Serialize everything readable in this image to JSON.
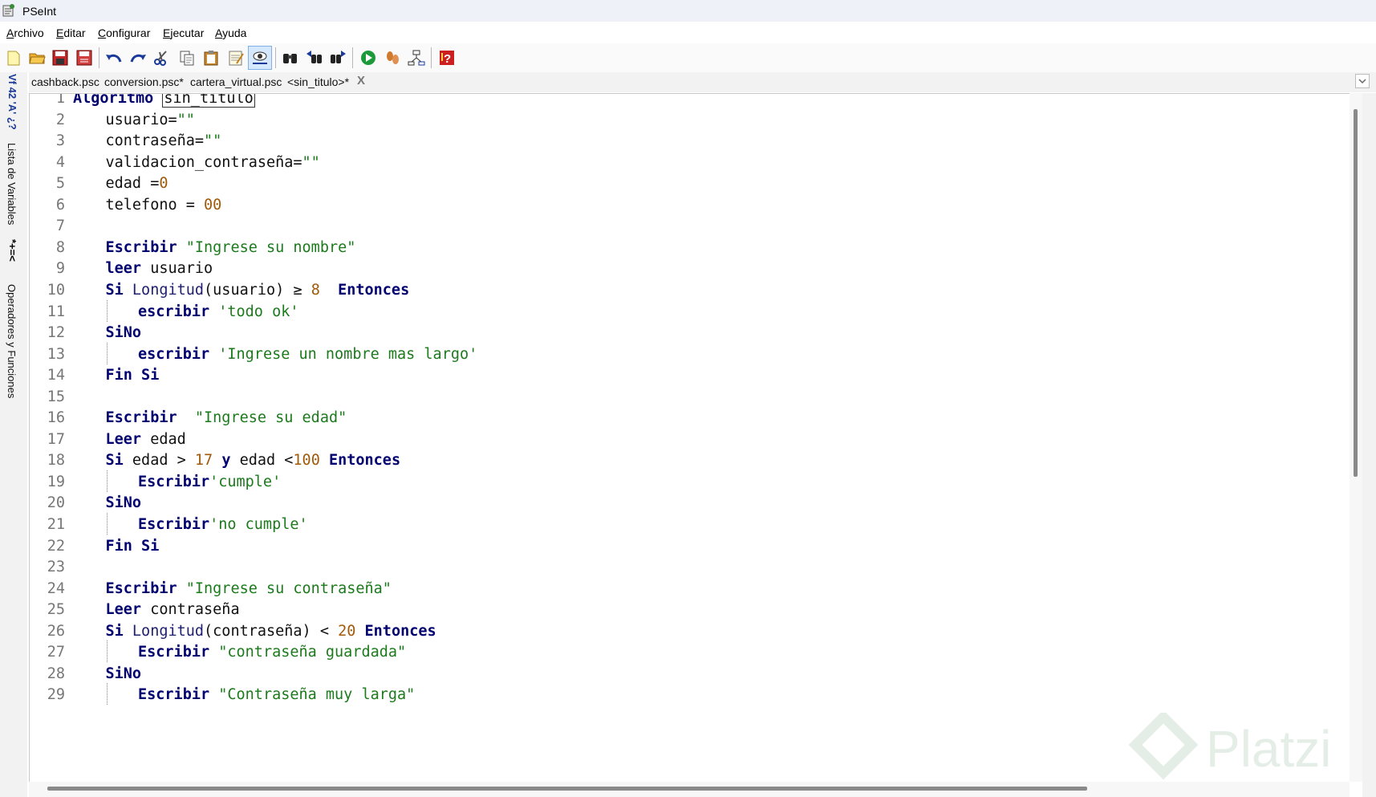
{
  "window": {
    "title": "PSeInt"
  },
  "menu": [
    {
      "label": "Archivo",
      "accel": "A",
      "rest": "rchivo"
    },
    {
      "label": "Editar",
      "accel": "E",
      "rest": "ditar"
    },
    {
      "label": "Configurar",
      "accel": "C",
      "rest": "onfigurar"
    },
    {
      "label": "Ejecutar",
      "accel": "E",
      "rest": "jecutar"
    },
    {
      "label": "Ayuda",
      "accel": "A",
      "rest": "yuda"
    }
  ],
  "toolbar": [
    "new-file-icon",
    "open-folder-icon",
    "save-icon",
    "save-as-icon",
    "undo-icon",
    "redo-icon",
    "cut-icon",
    "copy-icon",
    "paste-icon",
    "edit-icon",
    "highlight-icon",
    "find-icon",
    "find-previous-icon",
    "find-next-icon",
    "run-icon",
    "step-by-step-icon",
    "flowchart-icon",
    "help-icon"
  ],
  "tabs": [
    {
      "label": "cashback.psc"
    },
    {
      "label": "conversion.psc*"
    },
    {
      "label": "cartera_virtual.psc"
    },
    {
      "label": "<sin_titulo>*",
      "active": true
    }
  ],
  "tab_close": "X",
  "side_panel": {
    "variables_label": "Lista de Variables",
    "variables_glyphs": "Vf 42 'A' ¿?",
    "operators_label": "Operadores y Funciones",
    "operators_glyphs": "*+=<"
  },
  "code_lines": [
    {
      "n": "1",
      "indent": 0,
      "tokens": [
        [
          "kw",
          "Algoritmo"
        ],
        [
          "id",
          " "
        ],
        [
          "box",
          "sin_titulo"
        ]
      ]
    },
    {
      "n": "2",
      "indent": 1,
      "tokens": [
        [
          "id",
          "usuario="
        ],
        [
          "str",
          "\"\""
        ]
      ]
    },
    {
      "n": "3",
      "indent": 1,
      "tokens": [
        [
          "id",
          "contraseña="
        ],
        [
          "str",
          "\"\""
        ]
      ]
    },
    {
      "n": "4",
      "indent": 1,
      "tokens": [
        [
          "id",
          "validacion_contraseña="
        ],
        [
          "str",
          "\"\""
        ]
      ]
    },
    {
      "n": "5",
      "indent": 1,
      "tokens": [
        [
          "id",
          "edad ="
        ],
        [
          "num",
          "0"
        ]
      ]
    },
    {
      "n": "6",
      "indent": 1,
      "tokens": [
        [
          "id",
          "telefono = "
        ],
        [
          "num",
          "00"
        ]
      ]
    },
    {
      "n": "7",
      "indent": 0,
      "tokens": []
    },
    {
      "n": "8",
      "indent": 1,
      "tokens": [
        [
          "kw",
          "Escribir"
        ],
        [
          "id",
          " "
        ],
        [
          "str",
          "\"Ingrese su nombre\""
        ]
      ]
    },
    {
      "n": "9",
      "indent": 1,
      "tokens": [
        [
          "kw",
          "leer"
        ],
        [
          "id",
          " usuario"
        ]
      ]
    },
    {
      "n": "10",
      "indent": 1,
      "tokens": [
        [
          "kw",
          "Si"
        ],
        [
          "id",
          " "
        ],
        [
          "fn",
          "Longitud"
        ],
        [
          "id",
          "(usuario) ≥ "
        ],
        [
          "num",
          "8"
        ],
        [
          "id",
          "  "
        ],
        [
          "kw",
          "Entonces"
        ]
      ]
    },
    {
      "n": "11",
      "indent": 2,
      "tokens": [
        [
          "kw",
          "escribir"
        ],
        [
          "id",
          " "
        ],
        [
          "str",
          "'todo ok'"
        ]
      ]
    },
    {
      "n": "12",
      "indent": 1,
      "tokens": [
        [
          "kw",
          "SiNo"
        ]
      ]
    },
    {
      "n": "13",
      "indent": 2,
      "tokens": [
        [
          "kw",
          "escribir"
        ],
        [
          "id",
          " "
        ],
        [
          "str",
          "'Ingrese un nombre mas largo'"
        ]
      ]
    },
    {
      "n": "14",
      "indent": 1,
      "tokens": [
        [
          "kw",
          "Fin Si"
        ]
      ]
    },
    {
      "n": "15",
      "indent": 0,
      "tokens": []
    },
    {
      "n": "16",
      "indent": 1,
      "tokens": [
        [
          "kw",
          "Escribir"
        ],
        [
          "id",
          "  "
        ],
        [
          "str",
          "\"Ingrese su edad\""
        ]
      ]
    },
    {
      "n": "17",
      "indent": 1,
      "tokens": [
        [
          "kw",
          "Leer"
        ],
        [
          "id",
          " edad"
        ]
      ]
    },
    {
      "n": "18",
      "indent": 1,
      "tokens": [
        [
          "kw",
          "Si"
        ],
        [
          "id",
          " edad > "
        ],
        [
          "num",
          "17"
        ],
        [
          "id",
          " "
        ],
        [
          "kw",
          "y"
        ],
        [
          "id",
          " edad <"
        ],
        [
          "num",
          "100"
        ],
        [
          "id",
          " "
        ],
        [
          "kw",
          "Entonces"
        ]
      ]
    },
    {
      "n": "19",
      "indent": 2,
      "tokens": [
        [
          "kw",
          "Escribir"
        ],
        [
          "str",
          "'cumple'"
        ]
      ]
    },
    {
      "n": "20",
      "indent": 1,
      "tokens": [
        [
          "kw",
          "SiNo"
        ]
      ]
    },
    {
      "n": "21",
      "indent": 2,
      "tokens": [
        [
          "kw",
          "Escribir"
        ],
        [
          "str",
          "'no cumple'"
        ]
      ]
    },
    {
      "n": "22",
      "indent": 1,
      "tokens": [
        [
          "kw",
          "Fin Si"
        ]
      ]
    },
    {
      "n": "23",
      "indent": 0,
      "tokens": []
    },
    {
      "n": "24",
      "indent": 1,
      "tokens": [
        [
          "kw",
          "Escribir"
        ],
        [
          "id",
          " "
        ],
        [
          "str",
          "\"Ingrese su contraseña\""
        ]
      ]
    },
    {
      "n": "25",
      "indent": 1,
      "tokens": [
        [
          "kw",
          "Leer"
        ],
        [
          "id",
          " contraseña"
        ]
      ]
    },
    {
      "n": "26",
      "indent": 1,
      "tokens": [
        [
          "kw",
          "Si"
        ],
        [
          "id",
          " "
        ],
        [
          "fn",
          "Longitud"
        ],
        [
          "id",
          "(contraseña) < "
        ],
        [
          "num",
          "20"
        ],
        [
          "id",
          " "
        ],
        [
          "kw",
          "Entonces"
        ]
      ]
    },
    {
      "n": "27",
      "indent": 2,
      "tokens": [
        [
          "kw",
          "Escribir"
        ],
        [
          "id",
          " "
        ],
        [
          "str",
          "\"contraseña guardada\""
        ]
      ]
    },
    {
      "n": "28",
      "indent": 1,
      "tokens": [
        [
          "kw",
          "SiNo"
        ]
      ]
    },
    {
      "n": "29",
      "indent": 2,
      "tokens": [
        [
          "kw",
          "Escribir"
        ],
        [
          "id",
          " "
        ],
        [
          "str",
          "\"Contraseña muy larga\""
        ]
      ]
    }
  ],
  "watermark": "Platzi"
}
